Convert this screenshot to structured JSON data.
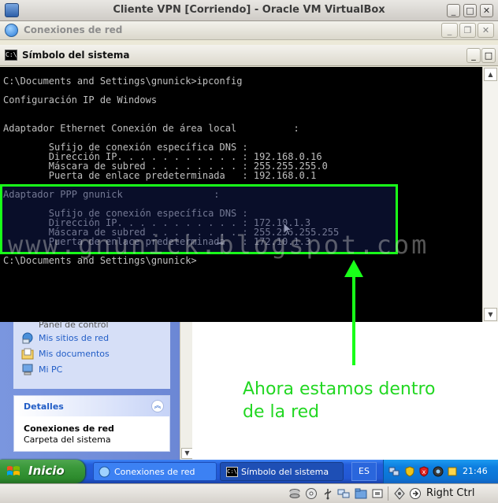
{
  "vbox": {
    "title": "Cliente VPN [Corriendo] - Oracle VM VirtualBox",
    "host_key": "Right Ctrl"
  },
  "explorer": {
    "title": "Conexiones de red",
    "task_items": [
      "Panel de control",
      "Mis sitios de red",
      "Mis documentos",
      "Mi PC"
    ],
    "details": {
      "header": "Detalles",
      "name": "Conexiones de red",
      "type": "Carpeta del sistema"
    }
  },
  "cmd": {
    "title": "Símbolo del sistema",
    "lines": [
      "C:\\Documents and Settings\\gnunick>ipconfig",
      "Configuración IP de Windows",
      "Adaptador Ethernet Conexión de área local          :",
      "        Sufijo de conexión específica DNS :",
      "        Dirección IP. . . . . . . . . . . : 192.168.0.16",
      "        Máscara de subred . . . . . . . . : 255.255.255.0",
      "        Puerta de enlace predeterminada   : 192.168.0.1",
      "Adaptador PPP gnunick                :",
      "        Sufijo de conexión específica DNS :",
      "        Dirección IP. . . . . . . . . . . : 172.10.1.3",
      "        Máscara de subred . . . . . . . . : 255.255.255.255",
      "        Puerta de enlace predeterminada   : 172.10.1.3",
      "C:\\Documents and Settings\\gnunick>"
    ]
  },
  "watermark": "www.gnunick.blogspot.com",
  "annotation": [
    "Ahora estamos dentro",
    "de la red"
  ],
  "taskbar": {
    "start_label": "Inicio",
    "buttons": [
      "Conexiones de red",
      "Símbolo del sistema"
    ],
    "language": "ES",
    "clock": "21:46"
  },
  "colors": {
    "highlight": "#19ff19",
    "annotation": "#22d722",
    "console_bg": "#000000",
    "console_text": "#c0c0c0",
    "taskbar_blue": "#245edb",
    "start_green": "#3c9a3c"
  }
}
